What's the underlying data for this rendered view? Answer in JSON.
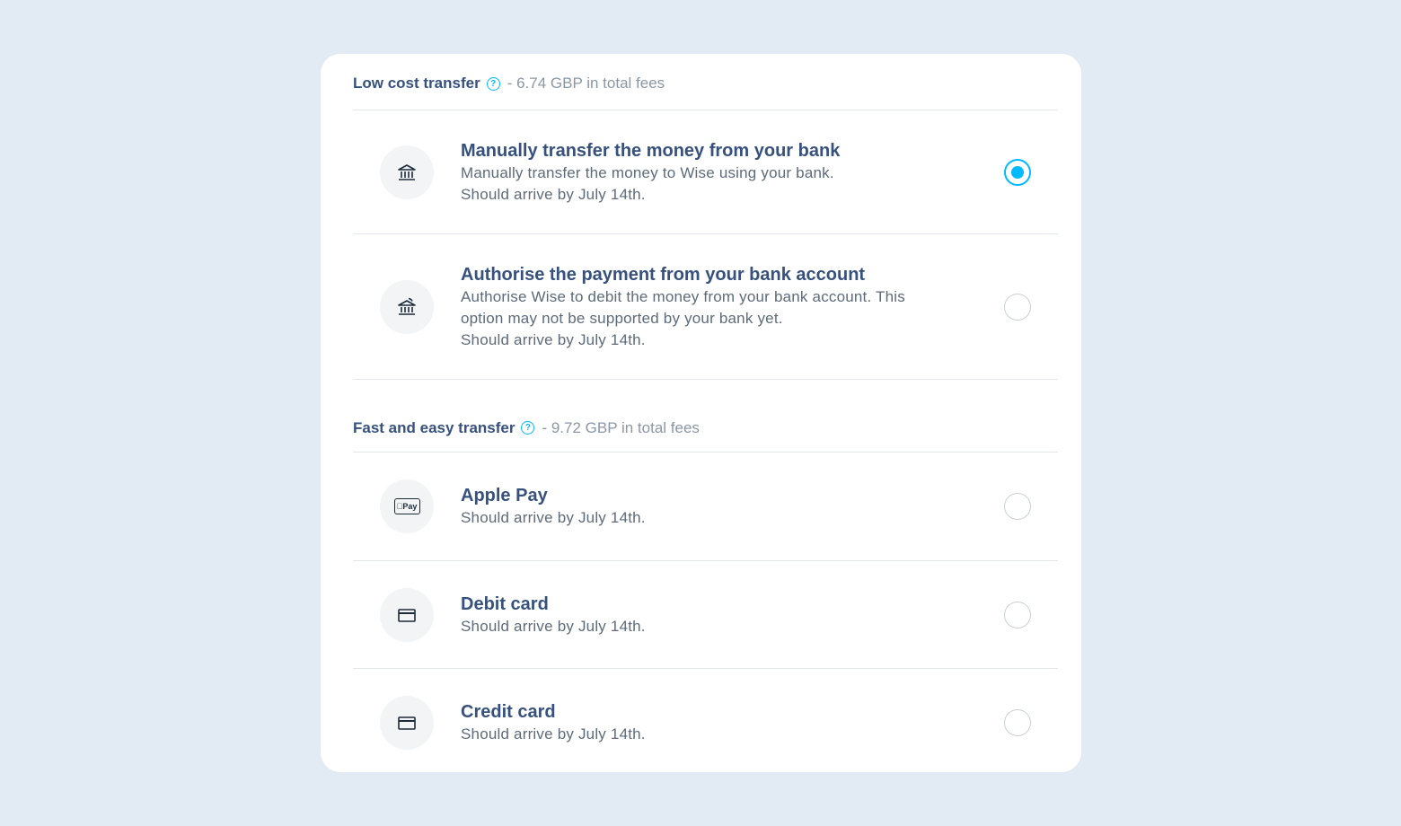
{
  "sections": [
    {
      "title": "Low cost transfer",
      "fee_text": "- 6.74 GBP in total fees",
      "options": [
        {
          "icon": "bank-icon",
          "title": "Manually transfer the money from your bank",
          "desc_lines": [
            "Manually transfer the money to Wise using your bank.",
            "Should arrive by July 14th."
          ],
          "selected": true
        },
        {
          "icon": "bank-authorise-icon",
          "title": "Authorise the payment from your bank account",
          "desc_lines": [
            "Authorise Wise to debit the money from your bank account. This",
            "option may not be supported by your bank yet.",
            "Should arrive by July 14th."
          ],
          "selected": false
        }
      ]
    },
    {
      "title": "Fast and easy transfer",
      "fee_text": "- 9.72 GBP in total fees",
      "options": [
        {
          "icon": "apple-pay-icon",
          "icon_text": "Pay",
          "title": "Apple Pay",
          "desc_lines": [
            "Should arrive by July 14th."
          ],
          "selected": false
        },
        {
          "icon": "card-icon",
          "title": "Debit card",
          "desc_lines": [
            "Should arrive by July 14th."
          ],
          "selected": false
        },
        {
          "icon": "card-icon",
          "title": "Credit card",
          "desc_lines": [
            "Should arrive by July 14th."
          ],
          "selected": false
        }
      ]
    }
  ],
  "help_glyph": "?",
  "colors": {
    "accent": "#00b9ff",
    "text": "#37517e",
    "muted": "#8a97a4",
    "background": "#e2ebf4"
  }
}
